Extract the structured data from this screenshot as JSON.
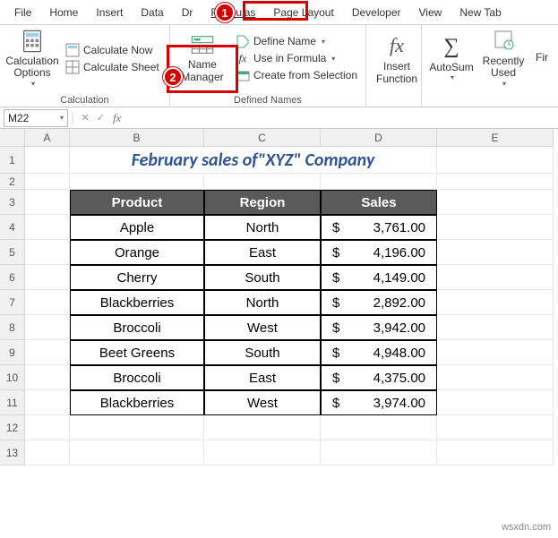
{
  "tabs": {
    "file": "File",
    "home": "Home",
    "insert": "Insert",
    "data": "Data",
    "draw": "Dr",
    "formulas": "Formulas",
    "pagelayout": "Page Layout",
    "developer": "Developer",
    "view": "View",
    "newtab": "New Tab"
  },
  "ribbon": {
    "calc": {
      "options": "Calculation\nOptions",
      "now": "Calculate Now",
      "sheet": "Calculate Sheet",
      "group": "Calculation"
    },
    "defined": {
      "manager": "Name\nManager",
      "define": "Define Name",
      "use": "Use in Formula",
      "create": "Create from Selection",
      "group": "Defined Names"
    },
    "insertfn": "Insert\nFunction",
    "autosum": "AutoSum",
    "recent": "Recently\nUsed",
    "fin": "Fir"
  },
  "namebox": "M22",
  "columns": [
    "A",
    "B",
    "C",
    "D",
    "E"
  ],
  "rows": [
    "1",
    "2",
    "3",
    "4",
    "5",
    "6",
    "7",
    "8",
    "9",
    "10",
    "11",
    "12",
    "13"
  ],
  "title": "February sales of\"XYZ\" Company",
  "headers": {
    "product": "Product",
    "region": "Region",
    "sales": "Sales"
  },
  "data": [
    {
      "product": "Apple",
      "region": "North",
      "cur": "$",
      "val": "3,761.00"
    },
    {
      "product": "Orange",
      "region": "East",
      "cur": "$",
      "val": "4,196.00"
    },
    {
      "product": "Cherry",
      "region": "South",
      "cur": "$",
      "val": "4,149.00"
    },
    {
      "product": "Blackberries",
      "region": "North",
      "cur": "$",
      "val": "2,892.00"
    },
    {
      "product": "Broccoli",
      "region": "West",
      "cur": "$",
      "val": "3,942.00"
    },
    {
      "product": "Beet Greens",
      "region": "South",
      "cur": "$",
      "val": "4,948.00"
    },
    {
      "product": "Broccoli",
      "region": "East",
      "cur": "$",
      "val": "4,375.00"
    },
    {
      "product": "Blackberries",
      "region": "West",
      "cur": "$",
      "val": "3,974.00"
    }
  ],
  "callouts": {
    "c1": "1",
    "c2": "2"
  },
  "watermark": "wsxdn.com",
  "chart_data": {
    "type": "table",
    "title": "February sales of \"XYZ\" Company",
    "columns": [
      "Product",
      "Region",
      "Sales"
    ],
    "rows": [
      [
        "Apple",
        "North",
        3761.0
      ],
      [
        "Orange",
        "East",
        4196.0
      ],
      [
        "Cherry",
        "South",
        4149.0
      ],
      [
        "Blackberries",
        "North",
        2892.0
      ],
      [
        "Broccoli",
        "West",
        3942.0
      ],
      [
        "Beet Greens",
        "South",
        4948.0
      ],
      [
        "Broccoli",
        "East",
        4375.0
      ],
      [
        "Blackberries",
        "West",
        3974.0
      ]
    ]
  }
}
